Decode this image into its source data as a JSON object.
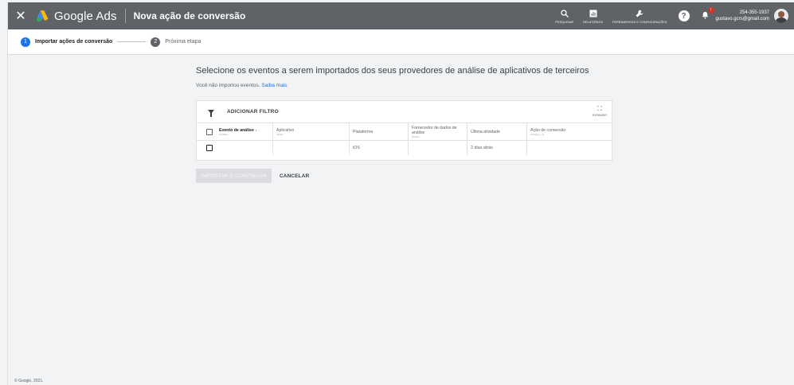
{
  "topbar": {
    "close_glyph": "✕",
    "brand": "Google Ads",
    "title": "Nova ação de conversão",
    "tools": [
      {
        "icon": "search-icon",
        "glyph": "🔍",
        "label": "PESQUISAR"
      },
      {
        "icon": "reports-icon",
        "glyph": "▥",
        "label": "RELATÓRIOS"
      },
      {
        "icon": "wrench-icon",
        "glyph": "🔧",
        "label": "FERRAMENTAS E CONFIGURAÇÕES"
      }
    ],
    "help_glyph": "?",
    "bell_glyph": "🔔",
    "bell_badge": "!",
    "account_phone": "254-355-1937",
    "account_email": "gustavo.gcrs@gmail.com"
  },
  "stepper": {
    "steps": [
      {
        "num": "1",
        "label": "Importar ações de conversão",
        "active": true
      },
      {
        "num": "2",
        "label": "Próxima etapa",
        "active": false
      }
    ]
  },
  "main": {
    "heading": "Selecione os eventos a serem importados dos seus provedores de análise de aplicativos de terceiros",
    "info_text": "Você não importou eventos.",
    "info_link": "Saiba mais",
    "filter_label": "ADICIONAR FILTRO",
    "expand_label": "EXPANDIR",
    "columns": [
      {
        "label": "Evento de análise",
        "sort": "↓",
        "sub": "Portfólios"
      },
      {
        "label": "Aplicativo",
        "sub": "Ativado"
      },
      {
        "label": "Plataforma",
        "sub": ""
      },
      {
        "label": "Fornecedor de dados de análise",
        "sub": "Primário"
      },
      {
        "label": "Última atividade",
        "sub": ""
      },
      {
        "label": "Ação de conversão",
        "sub": "Contagem_ma"
      }
    ],
    "rows": [
      {
        "event": "",
        "app": "",
        "platform": "iOS",
        "provider": "",
        "last_activity": "2 dias atrás",
        "conversion_action": ""
      }
    ],
    "import_button": "IMPORTAR E CONTINUAR",
    "cancel_button": "CANCELAR"
  },
  "footer": {
    "copyright": "© Google, 2021."
  },
  "colors": {
    "topbar": "#5f6368",
    "accent": "#1a73e8",
    "background": "#f1f3f4"
  }
}
